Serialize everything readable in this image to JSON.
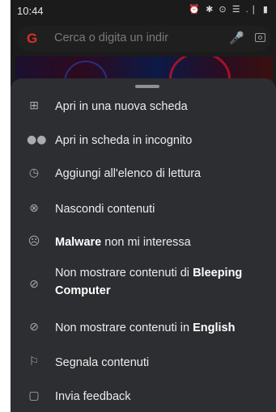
{
  "status_bar": {
    "time": "10:44",
    "icons": "⏰ ✱ ⊙ ☰ .❘ ▮"
  },
  "search_bar": {
    "placeholder": "Cerca o digita un indir",
    "google_glyph": "G"
  },
  "menu": {
    "items": [
      {
        "icon": "open-new-tab-icon",
        "label": "Apri in una nuova scheda"
      },
      {
        "icon": "incognito-icon",
        "label": "Apri in scheda in incognito"
      },
      {
        "icon": "reading-list-icon",
        "label": "Aggiungi all'elenco di lettura"
      },
      {
        "icon": "hide-content-icon",
        "label": "Nascondi contenuti"
      },
      {
        "icon": "sad-face-icon",
        "label_bold": "Malware",
        "label_rest": " non mi interessa"
      },
      {
        "icon": "block-icon",
        "label_rest": "Non mostrare contenuti di ",
        "label_bold": "Bleeping Computer"
      },
      {
        "icon": "block-icon",
        "label_rest": "Non mostrare contenuti in ",
        "label_bold": "English"
      },
      {
        "icon": "flag-icon",
        "label": "Segnala contenuti"
      },
      {
        "icon": "feedback-icon",
        "label": "Invia feedback"
      }
    ]
  }
}
